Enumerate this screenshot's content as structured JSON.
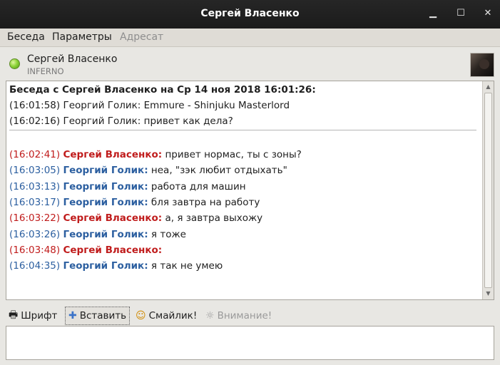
{
  "window": {
    "title": "Сергей Власенко",
    "minimize": "▁",
    "maximize": "☐",
    "close": "✕"
  },
  "menu": {
    "items": [
      {
        "label": "Беседа",
        "enabled": true
      },
      {
        "label": "Параметры",
        "enabled": true
      },
      {
        "label": "Адресат",
        "enabled": false
      }
    ]
  },
  "contact": {
    "name": "Сергей Власенко",
    "status_text": "INFERNO",
    "status_color": "#8fd43a"
  },
  "conversation": {
    "header": "Беседа с Сергей Власенко на Ср 14 ноя 2018 16:01:26:",
    "history": [
      "(16:01:58) Георгий Голик: Emmure -  Shinjuku Masterlord",
      "(16:02:16) Георгий Голик: привет как дела?"
    ],
    "messages": [
      {
        "time": "(16:02:41)",
        "sender": "Сергей Власенко:",
        "text": "привет нормас, ты с зоны?",
        "color": "red"
      },
      {
        "time": "(16:03:05)",
        "sender": "Георгий Голик:",
        "text": "неа, \"зэк любит отдыхать\"",
        "color": "blue"
      },
      {
        "time": "(16:03:13)",
        "sender": "Георгий Голик:",
        "text": "работа для машин",
        "color": "blue"
      },
      {
        "time": "(16:03:17)",
        "sender": "Георгий Голик:",
        "text": "бля завтра на работу",
        "color": "blue"
      },
      {
        "time": "(16:03:22)",
        "sender": "Сергей Власенко:",
        "text": "а, я завтра выхожу",
        "color": "red"
      },
      {
        "time": "(16:03:26)",
        "sender": "Георгий Голик:",
        "text": "я тоже",
        "color": "blue"
      },
      {
        "time": "(16:03:48)",
        "sender": "Сергей Власенко:",
        "text": "",
        "color": "red"
      },
      {
        "time": "(16:04:35)",
        "sender": "Георгий Голик:",
        "text": "я так не умею",
        "color": "blue"
      }
    ]
  },
  "toolbar": {
    "font_label": "Шрифт",
    "insert_label": "Вставить",
    "smiley_label": "Смайлик!",
    "attention_label": "Внимание!"
  },
  "input": {
    "value": ""
  }
}
